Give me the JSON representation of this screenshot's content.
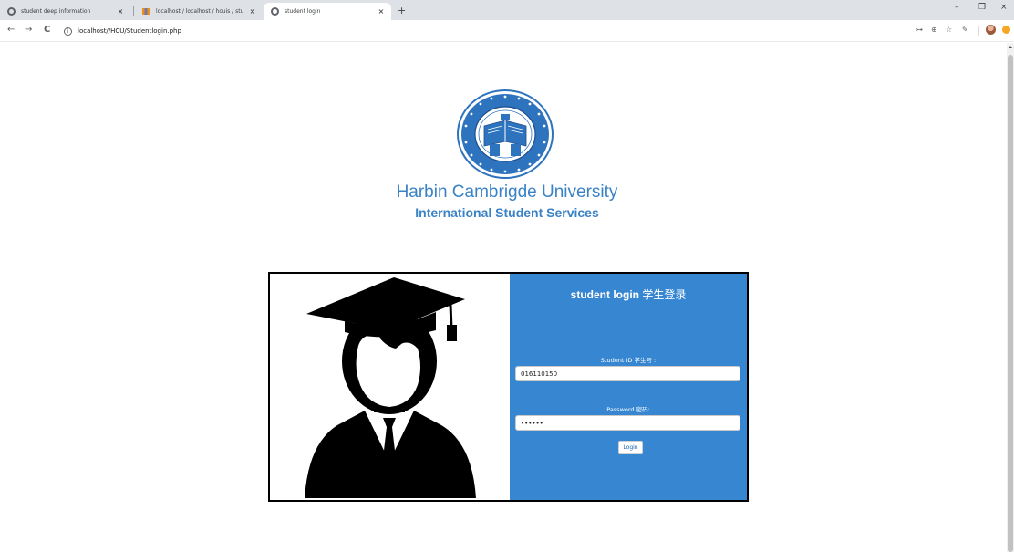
{
  "browser": {
    "tabs": [
      {
        "label": "student deep information",
        "icon": "globe-icon"
      },
      {
        "label": "localhost / localhost / hcuis / stu",
        "icon": "phpmyadmin-icon"
      },
      {
        "label": "student login",
        "icon": "globe-icon"
      }
    ],
    "active_tab_index": 2,
    "url": "localhost//HCU/Studentlogin.php",
    "icons": {
      "back": "←",
      "forward": "→",
      "reload": "C",
      "info": "i",
      "key": "⊶",
      "zoom": "⊕",
      "star": "☆",
      "pen": "✎",
      "close": "×",
      "new_tab": "+",
      "minimize": "–",
      "restore": "❐",
      "close_window": "×"
    }
  },
  "page": {
    "university_name": "Harbin Cambrigde University",
    "subtitle": "International Student Services",
    "login": {
      "title_en": "student login",
      "title_cn": "学生登录",
      "student_id_label": "Student ID 学生号 :",
      "student_id_value": "016110150",
      "password_label": "Password 密码:",
      "password_value": "••••••",
      "button_label": "Login"
    }
  },
  "colors": {
    "brand_blue": "#3a82c6",
    "panel_blue": "#3686d2",
    "tab_strip": "#dee1e6"
  }
}
